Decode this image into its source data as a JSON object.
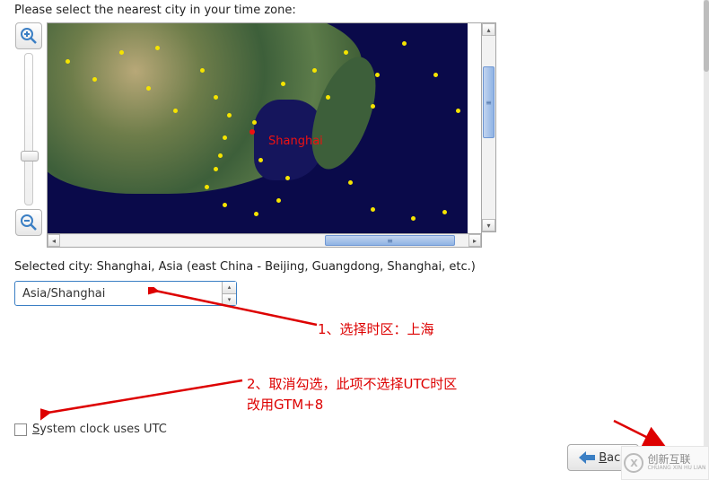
{
  "instruction": "Please select the nearest city in your time zone:",
  "map": {
    "marked_city_label": "Shanghai"
  },
  "selected_city_text": "Selected city: Shanghai, Asia (east China - Beijing, Guangdong, Shanghai, etc.)",
  "timezone_select": {
    "value": "Asia/Shanghai"
  },
  "utc_checkbox": {
    "label": "System clock uses UTC",
    "underlined_char": "S",
    "label_rest": "ystem clock uses UTC",
    "checked": false
  },
  "annotations": {
    "a1": "1、选择时区：上海",
    "a2_line1": "2、取消勾选，此项不选择UTC时区",
    "a2_line2": "改用GTM+8"
  },
  "buttons": {
    "back_label": "Back",
    "back_underlined": "B",
    "back_rest": "ack"
  },
  "watermark": {
    "logo_text": "X",
    "text_line1": "创新互联",
    "text_line2": "CHUANG XIN HU LIAN"
  },
  "icons": {
    "zoom_in": "zoom-in",
    "zoom_out": "zoom-out",
    "up": "▴",
    "down": "▾",
    "left": "◂",
    "right": "▸",
    "grip": "≡",
    "back_arrow": "⬅"
  }
}
